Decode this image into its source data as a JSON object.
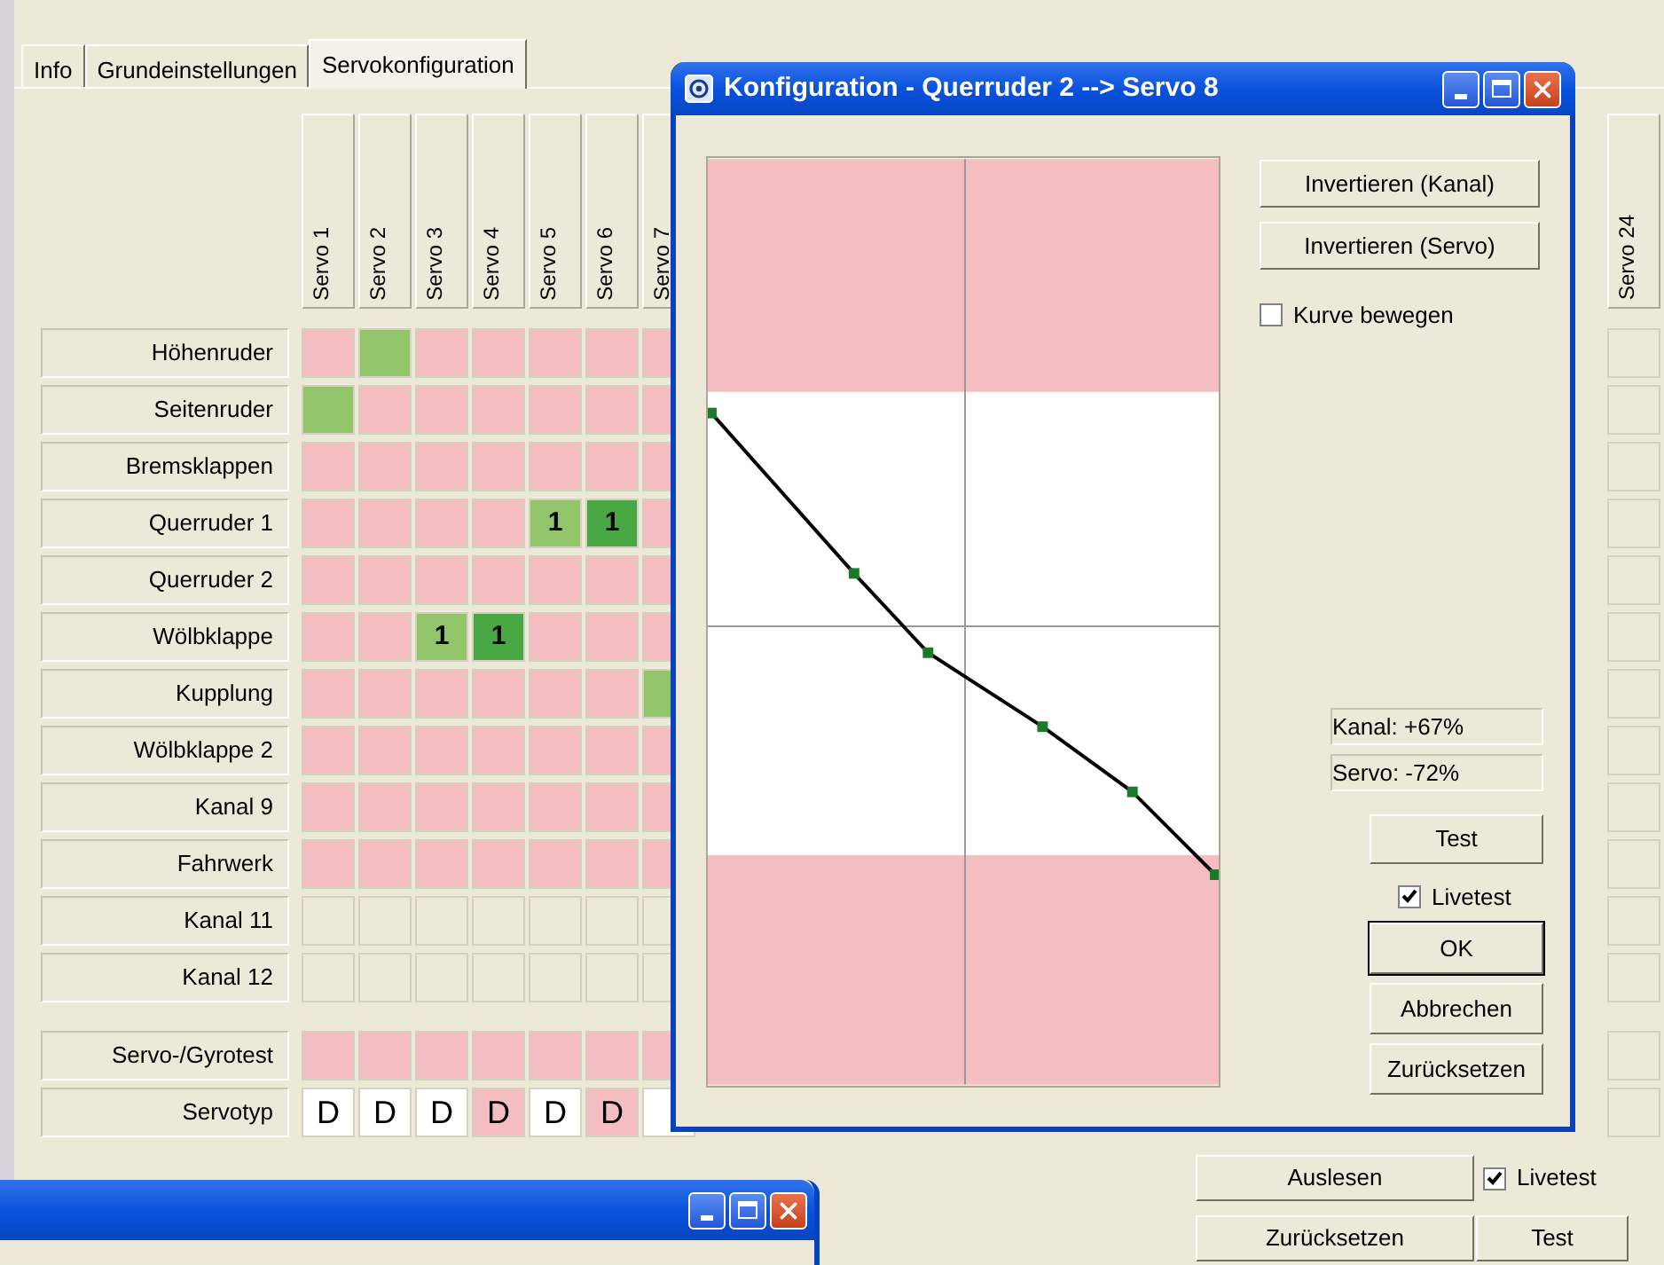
{
  "tabs": [
    {
      "label": "Info",
      "selected": false
    },
    {
      "label": "Grundeinstellungen",
      "selected": false
    },
    {
      "label": "Servokonfiguration",
      "selected": true
    }
  ],
  "grid": {
    "columns_left": [
      "Servo 1",
      "Servo 2",
      "Servo 3",
      "Servo 4",
      "Servo 5",
      "Servo 6",
      "Servo 7"
    ],
    "columns_right": [
      "Servo 24"
    ],
    "rows": [
      {
        "label": "Höhenruder",
        "cells_left": [
          {
            "color": "#f4bdc2"
          },
          {
            "color": "#92c46a"
          },
          {
            "color": "#f4bdc2"
          },
          {
            "color": "#f4bdc2"
          },
          {
            "color": "#f4bdc2"
          },
          {
            "color": "#f4bdc2"
          },
          {
            "color": "#f4bdc2"
          }
        ],
        "cells_right": [
          {
            "color": "#ece9d8"
          }
        ]
      },
      {
        "label": "Seitenruder",
        "cells_left": [
          {
            "color": "#92c46a"
          },
          {
            "color": "#f4bdc2"
          },
          {
            "color": "#f4bdc2"
          },
          {
            "color": "#f4bdc2"
          },
          {
            "color": "#f4bdc2"
          },
          {
            "color": "#f4bdc2"
          },
          {
            "color": "#f4bdc2"
          }
        ],
        "cells_right": [
          {
            "color": "#ece9d8"
          }
        ]
      },
      {
        "label": "Bremsklappen",
        "cells_left": [
          {
            "color": "#f4bdc2"
          },
          {
            "color": "#f4bdc2"
          },
          {
            "color": "#f4bdc2"
          },
          {
            "color": "#f4bdc2"
          },
          {
            "color": "#f4bdc2"
          },
          {
            "color": "#f4bdc2"
          },
          {
            "color": "#f4bdc2"
          }
        ],
        "cells_right": [
          {
            "color": "#ece9d8"
          }
        ]
      },
      {
        "label": "Querruder 1",
        "cells_left": [
          {
            "color": "#f4bdc2"
          },
          {
            "color": "#f4bdc2"
          },
          {
            "color": "#f4bdc2"
          },
          {
            "color": "#f4bdc2"
          },
          {
            "color": "#92c46a",
            "text": "1"
          },
          {
            "color": "#48a844",
            "text": "1"
          },
          {
            "color": "#f4bdc2"
          }
        ],
        "cells_right": [
          {
            "color": "#ece9d8"
          }
        ]
      },
      {
        "label": "Querruder 2",
        "cells_left": [
          {
            "color": "#f4bdc2"
          },
          {
            "color": "#f4bdc2"
          },
          {
            "color": "#f4bdc2"
          },
          {
            "color": "#f4bdc2"
          },
          {
            "color": "#f4bdc2"
          },
          {
            "color": "#f4bdc2"
          },
          {
            "color": "#f4bdc2"
          }
        ],
        "cells_right": [
          {
            "color": "#ece9d8"
          }
        ]
      },
      {
        "label": "Wölbklappe",
        "cells_left": [
          {
            "color": "#f4bdc2"
          },
          {
            "color": "#f4bdc2"
          },
          {
            "color": "#92c46a",
            "text": "1"
          },
          {
            "color": "#48a844",
            "text": "1"
          },
          {
            "color": "#f4bdc2"
          },
          {
            "color": "#f4bdc2"
          },
          {
            "color": "#f4bdc2"
          }
        ],
        "cells_right": [
          {
            "color": "#ece9d8"
          }
        ]
      },
      {
        "label": "Kupplung",
        "cells_left": [
          {
            "color": "#f4bdc2"
          },
          {
            "color": "#f4bdc2"
          },
          {
            "color": "#f4bdc2"
          },
          {
            "color": "#f4bdc2"
          },
          {
            "color": "#f4bdc2"
          },
          {
            "color": "#f4bdc2"
          },
          {
            "color": "#92c46a"
          }
        ],
        "cells_right": [
          {
            "color": "#ece9d8"
          }
        ]
      },
      {
        "label": "Wölbklappe 2",
        "cells_left": [
          {
            "color": "#f4bdc2"
          },
          {
            "color": "#f4bdc2"
          },
          {
            "color": "#f4bdc2"
          },
          {
            "color": "#f4bdc2"
          },
          {
            "color": "#f4bdc2"
          },
          {
            "color": "#f4bdc2"
          },
          {
            "color": "#f4bdc2"
          }
        ],
        "cells_right": [
          {
            "color": "#ece9d8"
          }
        ]
      },
      {
        "label": "Kanal 9",
        "cells_left": [
          {
            "color": "#f4bdc2"
          },
          {
            "color": "#f4bdc2"
          },
          {
            "color": "#f4bdc2"
          },
          {
            "color": "#f4bdc2"
          },
          {
            "color": "#f4bdc2"
          },
          {
            "color": "#f4bdc2"
          },
          {
            "color": "#f4bdc2"
          }
        ],
        "cells_right": [
          {
            "color": "#ece9d8"
          }
        ]
      },
      {
        "label": "Fahrwerk",
        "cells_left": [
          {
            "color": "#f4bdc2"
          },
          {
            "color": "#f4bdc2"
          },
          {
            "color": "#f4bdc2"
          },
          {
            "color": "#f4bdc2"
          },
          {
            "color": "#f4bdc2"
          },
          {
            "color": "#f4bdc2"
          },
          {
            "color": "#f4bdc2"
          }
        ],
        "cells_right": [
          {
            "color": "#ece9d8"
          }
        ]
      },
      {
        "label": "Kanal 11",
        "cells_left": [
          {
            "color": "#ece9d8"
          },
          {
            "color": "#ece9d8"
          },
          {
            "color": "#ece9d8"
          },
          {
            "color": "#ece9d8"
          },
          {
            "color": "#ece9d8"
          },
          {
            "color": "#ece9d8"
          },
          {
            "color": "#ece9d8"
          }
        ],
        "cells_right": [
          {
            "color": "#ece9d8"
          }
        ]
      },
      {
        "label": "Kanal 12",
        "cells_left": [
          {
            "color": "#ece9d8"
          },
          {
            "color": "#ece9d8"
          },
          {
            "color": "#ece9d8"
          },
          {
            "color": "#ece9d8"
          },
          {
            "color": "#ece9d8"
          },
          {
            "color": "#ece9d8"
          },
          {
            "color": "#ece9d8"
          }
        ],
        "cells_right": [
          {
            "color": "#ece9d8"
          }
        ]
      }
    ],
    "test_rows": [
      {
        "label": "Servo-/Gyrotest",
        "cells_left": [
          {
            "color": "#f4bdc2"
          },
          {
            "color": "#f4bdc2"
          },
          {
            "color": "#f4bdc2"
          },
          {
            "color": "#f4bdc2"
          },
          {
            "color": "#f4bdc2"
          },
          {
            "color": "#f4bdc2"
          },
          {
            "color": "#f4bdc2"
          }
        ],
        "cells_right": [
          {
            "color": "#ece9d8"
          }
        ]
      },
      {
        "label": "Servotyp",
        "cells_left": [
          {
            "color": "#ffffff",
            "text": "D"
          },
          {
            "color": "#ffffff",
            "text": "D"
          },
          {
            "color": "#ffffff",
            "text": "D"
          },
          {
            "color": "#f4bdc2",
            "text": "D"
          },
          {
            "color": "#ffffff",
            "text": "D"
          },
          {
            "color": "#f4bdc2",
            "text": "D"
          },
          {
            "color": "#ffffff"
          }
        ],
        "cells_right": [
          {
            "color": "#ece9d8"
          }
        ]
      }
    ]
  },
  "bottom": {
    "read_button": "Auslesen",
    "livetest": {
      "label": "Livetest",
      "checked": true
    },
    "reset_button": "Zurücksetzen",
    "test_button": "Test"
  },
  "dialog": {
    "title": "Konfiguration - Querruder 2 --> Servo 8",
    "top_buttons": [
      "Invertieren (Kanal)",
      "Invertieren (Servo)"
    ],
    "move_curve": {
      "label": "Kurve bewegen",
      "checked": false
    },
    "readouts": [
      "Kanal: +67%",
      "Servo: -72%"
    ],
    "test_button": "Test",
    "livetest": {
      "label": "Livetest",
      "checked": true
    },
    "buttons": [
      {
        "label": "OK",
        "default": true
      },
      {
        "label": "Abbrechen",
        "default": false
      },
      {
        "label": "Zurücksetzen",
        "default": false
      }
    ]
  }
}
